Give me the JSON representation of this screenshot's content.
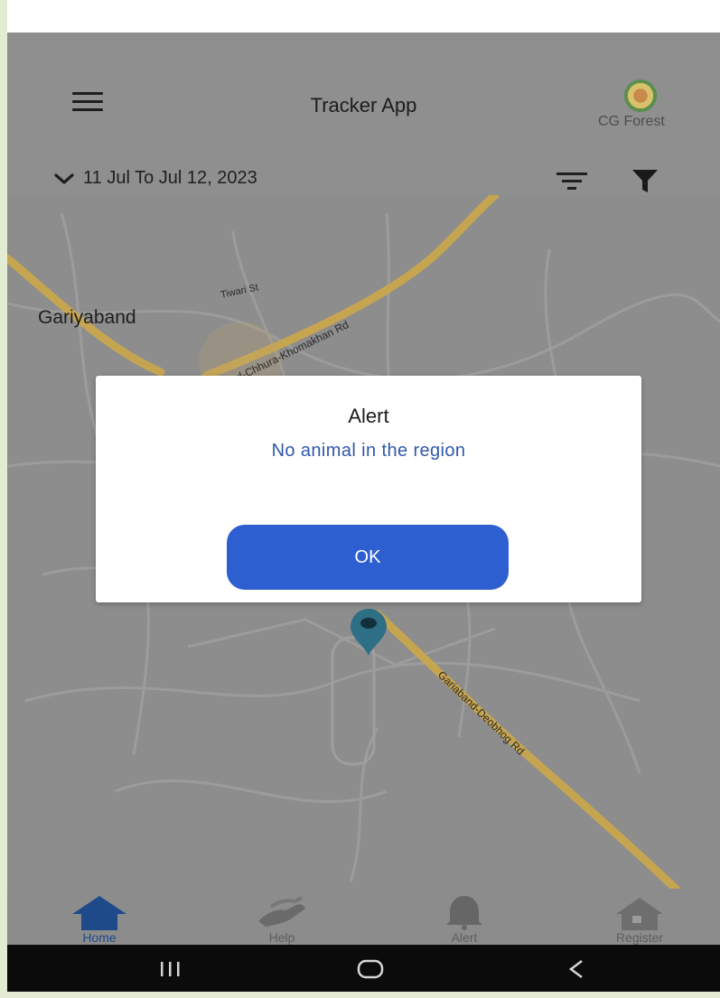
{
  "header": {
    "title": "Tracker App",
    "logo_label": "CG Forest",
    "date_range": "11 Jul To Jul 12, 2023",
    "menu_icon": "hamburger-menu-icon",
    "sort_icon": "sort-icon",
    "filter_icon": "filter-funnel-icon"
  },
  "map": {
    "town_label": "Gariyaband",
    "street_label": "Tiwari St",
    "road_label_1": "and-Chhura-Khomakhan Rd",
    "road_label_2": "Gariaband-Deobhog Rd"
  },
  "dialog": {
    "title": "Alert",
    "message": "No animal in the region",
    "ok_label": "OK"
  },
  "bottom_nav": {
    "items": [
      {
        "label": "Home",
        "icon": "home-icon",
        "active": true
      },
      {
        "label": "Help",
        "icon": "handshake-icon",
        "active": false
      },
      {
        "label": "Alert",
        "icon": "bell-icon",
        "active": false
      },
      {
        "label": "Register",
        "icon": "house-register-icon",
        "active": false
      }
    ]
  },
  "system_bar": {
    "recents_icon": "recents-icon",
    "home_icon": "system-home-icon",
    "back_icon": "back-icon"
  },
  "colors": {
    "accent": "#2e5fd1",
    "message_text": "#2f58a9",
    "home_active": "#1f4a8a",
    "road": "#c9a64e"
  }
}
